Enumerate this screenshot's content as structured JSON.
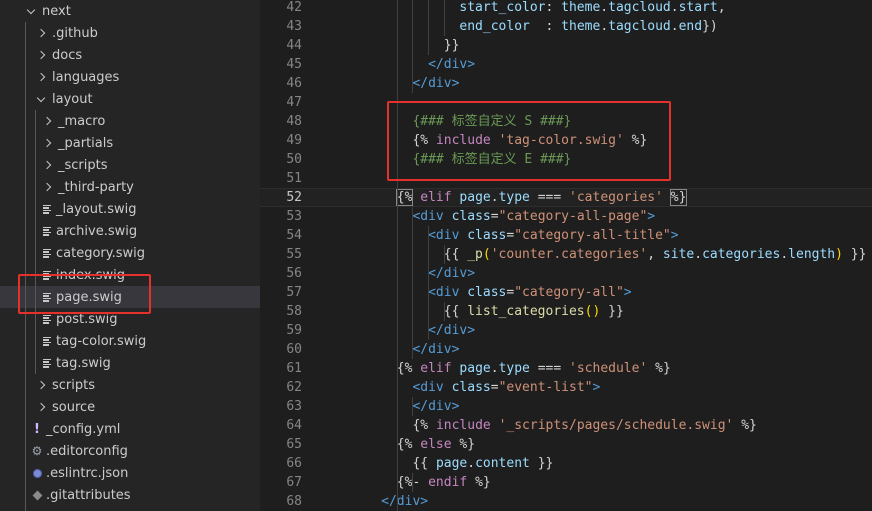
{
  "explorer": {
    "items": [
      {
        "label": "next",
        "icon": "chevron-down-icon"
      },
      {
        "label": ".github",
        "icon": "chevron-right-icon"
      },
      {
        "label": "docs",
        "icon": "chevron-right-icon"
      },
      {
        "label": "languages",
        "icon": "chevron-right-icon"
      },
      {
        "label": "layout",
        "icon": "chevron-down-icon"
      },
      {
        "label": "_macro",
        "icon": "chevron-right-icon"
      },
      {
        "label": "_partials",
        "icon": "chevron-right-icon"
      },
      {
        "label": "_scripts",
        "icon": "chevron-right-icon"
      },
      {
        "label": "_third-party",
        "icon": "chevron-right-icon"
      },
      {
        "label": "_layout.swig",
        "icon": "file-lines-icon"
      },
      {
        "label": "archive.swig",
        "icon": "file-lines-icon"
      },
      {
        "label": "category.swig",
        "icon": "file-lines-icon"
      },
      {
        "label": "index.swig",
        "icon": "file-lines-icon"
      },
      {
        "label": "page.swig",
        "icon": "file-lines-icon"
      },
      {
        "label": "post.swig",
        "icon": "file-lines-icon"
      },
      {
        "label": "tag-color.swig",
        "icon": "file-lines-icon"
      },
      {
        "label": "tag.swig",
        "icon": "file-lines-icon"
      },
      {
        "label": "scripts",
        "icon": "chevron-right-icon"
      },
      {
        "label": "source",
        "icon": "chevron-right-icon"
      },
      {
        "label": "_config.yml",
        "icon": "yaml-exclamation-icon"
      },
      {
        "label": ".editorconfig",
        "icon": "gear-icon"
      },
      {
        "label": ".eslintrc.json",
        "icon": "eslint-icon"
      },
      {
        "label": ".gitattributes",
        "icon": "git-icon"
      }
    ],
    "selected": "page.swig"
  },
  "editor": {
    "current_line": 52,
    "lines": [
      {
        "n": "42",
        "t": [
          [
            "               ",
            "d"
          ],
          [
            "start_color",
            "var"
          ],
          [
            ": ",
            "d"
          ],
          [
            "theme",
            "var"
          ],
          [
            ".",
            "d"
          ],
          [
            "tagcloud",
            "var"
          ],
          [
            ".",
            "d"
          ],
          [
            "start",
            "var"
          ],
          [
            ",",
            "d"
          ]
        ]
      },
      {
        "n": "43",
        "t": [
          [
            "               ",
            "d"
          ],
          [
            "end_color",
            "var"
          ],
          [
            "  : ",
            "d"
          ],
          [
            "theme",
            "var"
          ],
          [
            ".",
            "d"
          ],
          [
            "tagcloud",
            "var"
          ],
          [
            ".",
            "d"
          ],
          [
            "end",
            "var"
          ],
          [
            "})",
            "d"
          ]
        ]
      },
      {
        "n": "44",
        "t": [
          [
            "             ",
            "d"
          ],
          [
            "}}",
            "d"
          ]
        ]
      },
      {
        "n": "45",
        "t": [
          [
            "           ",
            "d"
          ],
          [
            "</",
            "tag"
          ],
          [
            "div",
            "tag"
          ],
          [
            ">",
            "tag"
          ]
        ]
      },
      {
        "n": "46",
        "t": [
          [
            "         ",
            "d"
          ],
          [
            "</",
            "tag"
          ],
          [
            "div",
            "tag"
          ],
          [
            ">",
            "tag"
          ]
        ]
      },
      {
        "n": "47",
        "t": []
      },
      {
        "n": "48",
        "t": [
          [
            "         ",
            "d"
          ],
          [
            "{### 标签自定义 S ###}",
            "com"
          ]
        ]
      },
      {
        "n": "49",
        "t": [
          [
            "         ",
            "d"
          ],
          [
            "{% ",
            "d"
          ],
          [
            "include",
            "kw"
          ],
          [
            " ",
            "d"
          ],
          [
            "'tag-color.swig'",
            "str"
          ],
          [
            " %}",
            "d"
          ]
        ]
      },
      {
        "n": "50",
        "t": [
          [
            "         ",
            "d"
          ],
          [
            "{### 标签自定义 E ###}",
            "com"
          ]
        ]
      },
      {
        "n": "51",
        "t": []
      },
      {
        "n": "52",
        "t": [
          [
            "       ",
            "d"
          ],
          [
            "{%",
            "d"
          ],
          [
            " ",
            "d"
          ],
          [
            "elif",
            "kw"
          ],
          [
            " ",
            "d"
          ],
          [
            "page",
            "var"
          ],
          [
            ".",
            "d"
          ],
          [
            "type",
            "var"
          ],
          [
            " === ",
            "d"
          ],
          [
            "'categories'",
            "str"
          ],
          [
            " ",
            "d"
          ],
          [
            "%}",
            "d"
          ]
        ]
      },
      {
        "n": "53",
        "t": [
          [
            "         ",
            "d"
          ],
          [
            "<",
            "tag"
          ],
          [
            "div",
            "tag"
          ],
          [
            " ",
            "d"
          ],
          [
            "class",
            "attr"
          ],
          [
            "=",
            "d"
          ],
          [
            "\"category-all-page\"",
            "str"
          ],
          [
            ">",
            "tag"
          ]
        ]
      },
      {
        "n": "54",
        "t": [
          [
            "           ",
            "d"
          ],
          [
            "<",
            "tag"
          ],
          [
            "div",
            "tag"
          ],
          [
            " ",
            "d"
          ],
          [
            "class",
            "attr"
          ],
          [
            "=",
            "d"
          ],
          [
            "\"category-all-title\"",
            "str"
          ],
          [
            ">",
            "tag"
          ]
        ]
      },
      {
        "n": "55",
        "t": [
          [
            "             ",
            "d"
          ],
          [
            "{{ ",
            "d"
          ],
          [
            "_p",
            "fn"
          ],
          [
            "(",
            "br"
          ],
          [
            "'counter.categories'",
            "str"
          ],
          [
            ", ",
            "d"
          ],
          [
            "site",
            "var"
          ],
          [
            ".",
            "d"
          ],
          [
            "categories",
            "var"
          ],
          [
            ".",
            "d"
          ],
          [
            "length",
            "var"
          ],
          [
            ")",
            "br"
          ],
          [
            " }}",
            "d"
          ]
        ]
      },
      {
        "n": "56",
        "t": [
          [
            "           ",
            "d"
          ],
          [
            "</",
            "tag"
          ],
          [
            "div",
            "tag"
          ],
          [
            ">",
            "tag"
          ]
        ]
      },
      {
        "n": "57",
        "t": [
          [
            "           ",
            "d"
          ],
          [
            "<",
            "tag"
          ],
          [
            "div",
            "tag"
          ],
          [
            " ",
            "d"
          ],
          [
            "class",
            "attr"
          ],
          [
            "=",
            "d"
          ],
          [
            "\"category-all\"",
            "str"
          ],
          [
            ">",
            "tag"
          ]
        ]
      },
      {
        "n": "58",
        "t": [
          [
            "             ",
            "d"
          ],
          [
            "{{ ",
            "d"
          ],
          [
            "list_categories",
            "fn"
          ],
          [
            "()",
            "br"
          ],
          [
            " }}",
            "d"
          ]
        ]
      },
      {
        "n": "59",
        "t": [
          [
            "           ",
            "d"
          ],
          [
            "</",
            "tag"
          ],
          [
            "div",
            "tag"
          ],
          [
            ">",
            "tag"
          ]
        ]
      },
      {
        "n": "60",
        "t": [
          [
            "         ",
            "d"
          ],
          [
            "</",
            "tag"
          ],
          [
            "div",
            "tag"
          ],
          [
            ">",
            "tag"
          ]
        ]
      },
      {
        "n": "61",
        "t": [
          [
            "       ",
            "d"
          ],
          [
            "{% ",
            "d"
          ],
          [
            "elif",
            "kw"
          ],
          [
            " ",
            "d"
          ],
          [
            "page",
            "var"
          ],
          [
            ".",
            "d"
          ],
          [
            "type",
            "var"
          ],
          [
            " === ",
            "d"
          ],
          [
            "'schedule'",
            "str"
          ],
          [
            " %}",
            "d"
          ]
        ]
      },
      {
        "n": "62",
        "t": [
          [
            "         ",
            "d"
          ],
          [
            "<",
            "tag"
          ],
          [
            "div",
            "tag"
          ],
          [
            " ",
            "d"
          ],
          [
            "class",
            "attr"
          ],
          [
            "=",
            "d"
          ],
          [
            "\"event-list\"",
            "str"
          ],
          [
            ">",
            "tag"
          ]
        ]
      },
      {
        "n": "63",
        "t": [
          [
            "         ",
            "d"
          ],
          [
            "</",
            "tag"
          ],
          [
            "div",
            "tag"
          ],
          [
            ">",
            "tag"
          ]
        ]
      },
      {
        "n": "64",
        "t": [
          [
            "         ",
            "d"
          ],
          [
            "{% ",
            "d"
          ],
          [
            "include",
            "kw"
          ],
          [
            " ",
            "d"
          ],
          [
            "'_scripts/pages/schedule.swig'",
            "str"
          ],
          [
            " %}",
            "d"
          ]
        ]
      },
      {
        "n": "65",
        "t": [
          [
            "       ",
            "d"
          ],
          [
            "{% ",
            "d"
          ],
          [
            "else",
            "kw"
          ],
          [
            " %}",
            "d"
          ]
        ]
      },
      {
        "n": "66",
        "t": [
          [
            "         ",
            "d"
          ],
          [
            "{{ ",
            "d"
          ],
          [
            "page",
            "var"
          ],
          [
            ".",
            "d"
          ],
          [
            "content",
            "var"
          ],
          [
            " }}",
            "d"
          ]
        ]
      },
      {
        "n": "67",
        "t": [
          [
            "       ",
            "d"
          ],
          [
            "{%- ",
            "d"
          ],
          [
            "endif",
            "kw"
          ],
          [
            " %}",
            "d"
          ]
        ]
      },
      {
        "n": "68",
        "t": [
          [
            "     ",
            "d"
          ],
          [
            "</",
            "tag"
          ],
          [
            "div",
            "tag"
          ],
          [
            ">",
            "tag"
          ]
        ]
      }
    ]
  }
}
